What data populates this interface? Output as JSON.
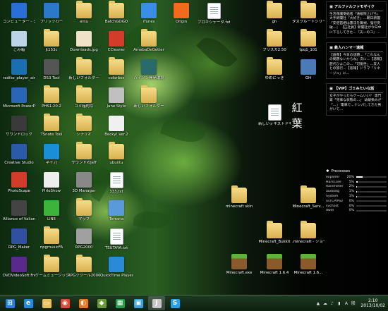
{
  "desktop": {
    "icons_col1": [
      {
        "label": "コンピューター - ショートカット",
        "icon": "computer-icon",
        "color": "#2a6fd8"
      },
      {
        "label": "ごみ箱",
        "icon": "recycle-bin-icon",
        "color": "#bcd3e8"
      },
      {
        "label": "radiko_player_air",
        "icon": "radio-icon",
        "color": "#1a6fb0"
      },
      {
        "label": "Microsoft PowerPoint",
        "icon": "powerpoint-icon",
        "color": "#2a66b5"
      },
      {
        "label": "サウンドロック",
        "icon": "sa-icon",
        "color": "#3a3a3a"
      },
      {
        "label": "Creative Studio",
        "icon": "creative-icon",
        "color": "#2b5aa8"
      },
      {
        "label": "PhotoScape",
        "icon": "photoscape-icon",
        "color": "#d33b2a"
      },
      {
        "label": "Alliance of Valiant Arms",
        "icon": "ava-icon",
        "color": "#444444"
      },
      {
        "label": "RPG_Maker",
        "icon": "rpg-icon",
        "color": "#3050a0"
      },
      {
        "label": "DVDVideoSoft Free Studio",
        "icon": "dvd-icon",
        "color": "#5a2a8a"
      }
    ],
    "icons_col2": [
      {
        "label": "ブリッツカー",
        "icon": "blue-app-icon",
        "color": "#2b7ac9"
      },
      {
        "label": "jt153c",
        "icon": "folder-icon",
        "color": "folder"
      },
      {
        "label": "DS3 Tool",
        "icon": "gamepad-icon",
        "color": "#555555"
      },
      {
        "label": "PHS1.20.2",
        "icon": "folder-icon",
        "color": "folder"
      },
      {
        "label": "TSnote Tool",
        "icon": "folder-icon",
        "color": "folder"
      },
      {
        "label": "ネイ刀",
        "icon": "blue-star-icon",
        "color": "#1b8ed8"
      },
      {
        "label": "PirloShow",
        "icon": "face-icon",
        "color": "#eeeeee"
      },
      {
        "label": "LINE",
        "icon": "line-icon",
        "color": "#3cb43c"
      },
      {
        "label": "npgmusicFA",
        "icon": "folder-icon",
        "color": "folder"
      },
      {
        "label": "ゲームミュージック",
        "icon": "folder-icon",
        "color": "folder"
      }
    ],
    "icons_col3": [
      {
        "label": "emu",
        "icon": "folder-icon",
        "color": "folder"
      },
      {
        "label": "Downloads.jpg",
        "icon": "image-icon",
        "color": "#efe2c8"
      },
      {
        "label": "新しいフォルダー",
        "icon": "folder-icon",
        "color": "folder"
      },
      {
        "label": "ゴミ箱的な",
        "icon": "folder-icon",
        "color": "folder"
      },
      {
        "label": "シナリオ",
        "icon": "folder-icon",
        "color": "folder"
      },
      {
        "label": "サウンドのJeff",
        "icon": "folder-icon",
        "color": "folder"
      },
      {
        "label": "3D Manager",
        "icon": "manager-icon",
        "color": "#888888"
      },
      {
        "label": "マップ",
        "icon": "folder-icon",
        "color": "folder"
      },
      {
        "label": "RPG2000",
        "icon": "castle-icon",
        "color": "#a0a0a0"
      },
      {
        "label": "RPGツクール2000",
        "icon": "folder-icon",
        "color": "folder"
      }
    ],
    "icons_col4": [
      {
        "label": "BatchGOGO",
        "icon": "folder-icon",
        "color": "folder"
      },
      {
        "label": "CCleaner",
        "icon": "ccleaner-icon",
        "color": "#d33b2a"
      },
      {
        "label": "colorbox",
        "icon": "folder-icon",
        "color": "folder"
      },
      {
        "label": "Jane Style",
        "icon": "jane-icon",
        "color": "#c0c0c0"
      },
      {
        "label": "Becky! Ver.2",
        "icon": "becky-icon",
        "color": "#f0f0f0"
      },
      {
        "label": "ubuntu",
        "icon": "folder-icon",
        "color": "folder"
      },
      {
        "label": "333.txt",
        "icon": "text-file-icon",
        "color": "doc"
      },
      {
        "label": "Terraria",
        "icon": "terraria-icon",
        "color": "#5a9adb"
      },
      {
        "label": "TSUTAYA.txt",
        "icon": "text-file-icon",
        "color": "doc"
      },
      {
        "label": "QuickTime Player",
        "icon": "quicktime-icon",
        "color": "#2a8ad8"
      }
    ],
    "icons_col5": [
      {
        "label": "iTunes",
        "icon": "itunes-icon",
        "color": "#3a8ee6"
      },
      {
        "label": "AmebaDeGetter",
        "icon": "folder-icon",
        "color": "folder"
      },
      {
        "label": "パイソン開発環境",
        "icon": "python-icon",
        "color": "#2a6a6a"
      },
      {
        "label": "新しいフォルダー",
        "icon": "folder-icon",
        "color": "folder"
      }
    ],
    "icons_col6": [
      {
        "label": "Origin",
        "icon": "origin-icon",
        "color": "#f26a1b"
      }
    ],
    "icons_col7": [
      {
        "label": "プロキシデータ.txt",
        "icon": "text-file-icon",
        "color": "doc"
      }
    ],
    "icons_col8": [
      {
        "label": "minecraft skin",
        "icon": "folder-icon",
        "color": "folder"
      },
      {
        "label": "Minecraft.exe",
        "icon": "minecraft-icon",
        "color": "grass"
      }
    ],
    "icons_col9": [
      {
        "label": "gh",
        "icon": "folder-icon",
        "color": "folder"
      },
      {
        "label": "プリズカ2.50",
        "icon": "folder-icon",
        "color": "folder"
      },
      {
        "label": "ゆめにっき",
        "icon": "folder-icon",
        "color": "folder"
      },
      {
        "label": "新しいテキストドキュメント.txt",
        "icon": "text-file-icon",
        "color": "doc"
      },
      {
        "label": "Minecraft_Bukkit",
        "icon": "folder-icon",
        "color": "folder"
      },
      {
        "label": "Minecraft 1.6.4",
        "icon": "minecraft-icon",
        "color": "grass"
      }
    ],
    "icons_col10": [
      {
        "label": "タスクルートシリーズ",
        "icon": "folder-icon",
        "color": "folder"
      },
      {
        "label": "tpq1_101",
        "icon": "folder-icon",
        "color": "folder"
      },
      {
        "label": "GH",
        "icon": "gh-icon",
        "color": "#4a7ab8"
      },
      {
        "label": "Minecraft_Serv...",
        "icon": "folder-icon",
        "color": "folder"
      },
      {
        "label": ".minecraft - ショートカット",
        "icon": "folder-icon",
        "color": "folder"
      },
      {
        "label": "Minecraft 1.6...",
        "icon": "minecraft-icon",
        "color": "grass"
      }
    ],
    "wallpaper_text": "紅葉"
  },
  "gadgets": {
    "feeds": [
      {
        "title": "アルファルファモザイク",
        "text": "生活保護受給者『通帳残上げろ』大手新聞社『大好き』…朝日新聞『安倍首相は憲法を無視、強行突破…』 【正社員】新聞社が今日中に下ろしてきた…『天一のコ』…"
      },
      {
        "title": "鉄人ハンマー速報",
        "text": "【画像】今日の話題…「これなんの問題ないからね」次に…【悲報】歴代ひよこの…「可能性」…友人との旅行…【悲報】ドラマ「リネージュ」に…"
      },
      {
        "title": "【VIP】ゴミみたいな話",
        "text": "女子がやったらゲームいい？ 専門家「見事な状態の…」 幼馴染みが「…」 電車で…ナンパしてきた男がいて…"
      }
    ],
    "processes": {
      "title": "Processes",
      "rows": [
        {
          "name": "explorer",
          "value": "20%",
          "level": 0.2
        },
        {
          "name": "HarsCore",
          "value": "5%",
          "level": 0.05
        },
        {
          "name": "Rainmeter",
          "value": "2%",
          "level": 0.02
        },
        {
          "name": "audiodg",
          "value": "1%",
          "level": 0.01
        },
        {
          "name": "System",
          "value": "1%",
          "level": 0.01
        },
        {
          "name": "nsTCPIPSv",
          "value": "0%",
          "level": 0.0
        },
        {
          "name": "svchost",
          "value": "0%",
          "level": 0.0
        },
        {
          "name": "dwm",
          "value": "0%",
          "level": 0.0
        }
      ]
    }
  },
  "taskbar": {
    "items": [
      {
        "name": "start",
        "glyph": "⊞",
        "color": "#2a7fd4"
      },
      {
        "name": "ie",
        "glyph": "e",
        "color": "#2a8ad8"
      },
      {
        "name": "explorer",
        "glyph": "▭",
        "color": "#e8c060"
      },
      {
        "name": "chrome",
        "glyph": "◉",
        "color": "#e04a3a"
      },
      {
        "name": "firefox",
        "glyph": "◐",
        "color": "#e67a22"
      },
      {
        "name": "minecraft",
        "glyph": "◆",
        "color": "#6a9a3a"
      },
      {
        "name": "store",
        "glyph": "▦",
        "color": "#2a9a4a"
      },
      {
        "name": "ipc",
        "glyph": "▣",
        "color": "#3aa6d8"
      },
      {
        "name": "jane",
        "glyph": "J",
        "color": "#c8c8c8"
      },
      {
        "name": "skype",
        "glyph": "S",
        "color": "#2aa0e0"
      }
    ],
    "tray": [
      "▲",
      "☁",
      "♪",
      "▮",
      "A",
      "般"
    ],
    "time": "2:10",
    "date": "2013/10/02"
  }
}
